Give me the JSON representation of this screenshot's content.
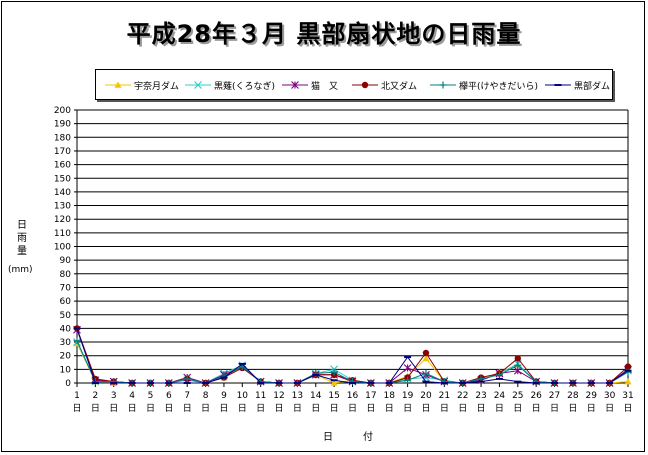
{
  "title": "平成28年３月  黒部扇状地の日雨量",
  "chart_data": {
    "type": "line",
    "title": "平成28年３月  黒部扇状地の日雨量",
    "ylabel_chars": [
      "日",
      "雨",
      "量"
    ],
    "yunit": "(mm)",
    "xlabel": "日　付",
    "ylim": [
      0,
      200
    ],
    "ytick_step": 10,
    "grid": true,
    "legend_position": "top",
    "x": [
      1,
      2,
      3,
      4,
      5,
      6,
      7,
      8,
      9,
      10,
      11,
      12,
      13,
      14,
      15,
      16,
      17,
      18,
      19,
      20,
      21,
      22,
      23,
      24,
      25,
      26,
      27,
      28,
      29,
      30,
      31
    ],
    "x_suffix": "日",
    "series": [
      {
        "name": "宇奈月ダム",
        "color": "#f5c400",
        "marker": "triangle",
        "values": [
          29,
          1,
          0,
          0,
          0,
          0,
          4,
          0,
          4,
          12,
          1,
          0,
          0,
          6,
          0,
          2,
          0,
          0,
          5,
          18,
          1,
          0,
          2,
          8,
          13,
          1,
          0,
          0,
          0,
          0,
          1
        ]
      },
      {
        "name": "黒薙(くろなぎ)",
        "color": "#33cccc",
        "marker": "x",
        "values": [
          30,
          1,
          1,
          0,
          0,
          0,
          2,
          0,
          7,
          13,
          1,
          0,
          0,
          7,
          10,
          2,
          0,
          0,
          3,
          4,
          2,
          0,
          2,
          7,
          14,
          1,
          0,
          0,
          0,
          0,
          9
        ]
      },
      {
        "name": "猫　又",
        "color": "#800080",
        "marker": "star",
        "values": [
          39,
          2,
          1,
          0,
          0,
          0,
          4,
          0,
          6,
          12,
          1,
          0,
          0,
          6,
          6,
          1,
          0,
          0,
          11,
          6,
          1,
          0,
          2,
          7,
          9,
          1,
          0,
          0,
          0,
          0,
          10
        ]
      },
      {
        "name": "北又ダム",
        "color": "#8b0000",
        "marker": "circle",
        "values": [
          40,
          3,
          1,
          0,
          0,
          0,
          3,
          0,
          4,
          11,
          1,
          0,
          0,
          6,
          6,
          2,
          0,
          0,
          4,
          22,
          1,
          0,
          4,
          7,
          18,
          1,
          0,
          0,
          0,
          0,
          12
        ]
      },
      {
        "name": "欅平(けやきだいら)",
        "color": "#008080",
        "marker": "plus",
        "values": [
          31,
          1,
          1,
          0,
          0,
          0,
          3,
          0,
          5,
          12,
          1,
          0,
          0,
          7,
          8,
          1,
          0,
          0,
          2,
          7,
          1,
          0,
          3,
          6,
          13,
          1,
          0,
          0,
          0,
          0,
          8
        ]
      },
      {
        "name": "黒部ダム",
        "color": "#000080",
        "marker": "dash",
        "values": [
          40,
          0,
          0,
          0,
          0,
          0,
          0,
          0,
          4,
          14,
          0,
          0,
          0,
          6,
          2,
          0,
          0,
          0,
          19,
          1,
          0,
          0,
          1,
          3,
          1,
          0,
          0,
          0,
          0,
          0,
          9
        ]
      }
    ]
  }
}
